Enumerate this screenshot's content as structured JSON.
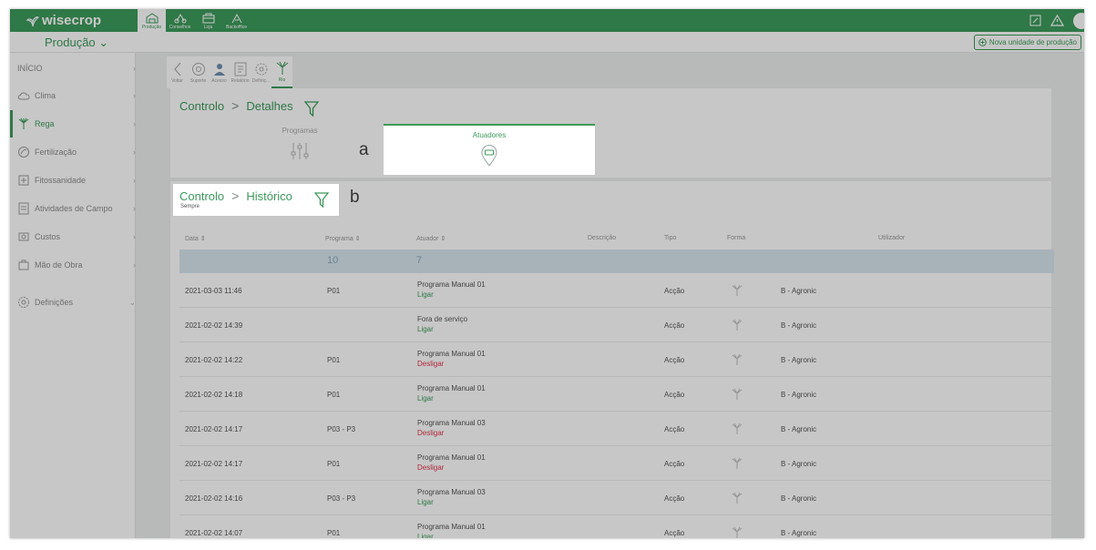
{
  "app": {
    "logo": "wisecrop"
  },
  "modules": [
    {
      "label": "Produção",
      "icon": "greenhouse-icon",
      "active": true
    },
    {
      "label": "Conselhos",
      "icon": "advisor-icon",
      "active": false
    },
    {
      "label": "Loja",
      "icon": "shop-icon",
      "active": false
    },
    {
      "label": "Backoffice",
      "icon": "backoffice-icon",
      "active": false
    }
  ],
  "subheader": {
    "production_select": "Produção ⌄",
    "new_unit_button": "Nova unidade de produção"
  },
  "sidebar": {
    "items": [
      {
        "label": "INÍCIO",
        "icon": ""
      },
      {
        "label": "Clima",
        "icon": "cloud-icon"
      },
      {
        "label": "Rega",
        "icon": "irrigation-icon"
      },
      {
        "label": "Fertilização",
        "icon": "fertilizer-icon"
      },
      {
        "label": "Fitossanidade",
        "icon": "plant-health-icon"
      },
      {
        "label": "Atividades de Campo",
        "icon": "field-activity-icon"
      },
      {
        "label": "Custos",
        "icon": "costs-icon"
      },
      {
        "label": "Mão de Obra",
        "icon": "labor-icon"
      },
      {
        "label": "Definições",
        "icon": "settings-icon"
      }
    ]
  },
  "toolbar": [
    {
      "label": "Voltar",
      "icon": "back-icon"
    },
    {
      "label": "Suporte",
      "icon": "support-icon"
    },
    {
      "label": "Acesso",
      "icon": "access-icon"
    },
    {
      "label": "Relatório",
      "icon": "report-icon"
    },
    {
      "label": "Definiç...",
      "icon": "settings-icon"
    },
    {
      "label": "Rio",
      "icon": "irrigation-icon"
    }
  ],
  "details": {
    "breadcrumb_root": "Controlo",
    "breadcrumb_sep": ">",
    "breadcrumb_page": "Detalhes",
    "tabs": {
      "programas": "Programas",
      "atuadores": "Atuadores"
    }
  },
  "history": {
    "breadcrumb_root": "Controlo",
    "breadcrumb_sep": ">",
    "breadcrumb_page": "Histórico",
    "period": "Sempre"
  },
  "annotations": {
    "a": "a",
    "b": "b"
  },
  "table": {
    "headers": {
      "date": "Data ⇕",
      "program": "Programa ⇕",
      "actuator": "Atuador ⇕",
      "description": "Descrição",
      "type": "Tipo",
      "form": "Forma",
      "user": "Utilizador"
    },
    "totals": {
      "program": "10",
      "actuator": "7"
    },
    "rows": [
      {
        "date": "2021-03-03 11:46",
        "program": "P01",
        "actuator": "Programa Manual 01",
        "action": "Ligar",
        "type": "Acção",
        "user": "B - Agronic"
      },
      {
        "date": "2021-02-02 14:39",
        "program": "",
        "actuator": "Fora de serviço",
        "action": "Ligar",
        "type": "Acção",
        "user": "B - Agronic"
      },
      {
        "date": "2021-02-02 14:22",
        "program": "P01",
        "actuator": "Programa Manual 01",
        "action": "Desligar",
        "type": "Acção",
        "user": "B - Agronic"
      },
      {
        "date": "2021-02-02 14:18",
        "program": "P01",
        "actuator": "Programa Manual 01",
        "action": "Ligar",
        "type": "Acção",
        "user": "B - Agronic"
      },
      {
        "date": "2021-02-02 14:17",
        "program": "P03 - P3",
        "actuator": "Programa Manual 03",
        "action": "Desligar",
        "type": "Acção",
        "user": "B - Agronic"
      },
      {
        "date": "2021-02-02 14:17",
        "program": "P01",
        "actuator": "Programa Manual 01",
        "action": "Desligar",
        "type": "Acção",
        "user": "B - Agronic"
      },
      {
        "date": "2021-02-02 14:16",
        "program": "P03 - P3",
        "actuator": "Programa Manual 03",
        "action": "Ligar",
        "type": "Acção",
        "user": "B - Agronic"
      },
      {
        "date": "2021-02-02 14:07",
        "program": "P01",
        "actuator": "Programa Manual 01",
        "action": "Ligar",
        "type": "Acção",
        "user": "B - Agronic"
      }
    ]
  },
  "colors": {
    "brand": "#3d9a5b",
    "on": "#3d9a5b",
    "off": "#e0344f",
    "totals_bg": "#d6e6ee"
  }
}
